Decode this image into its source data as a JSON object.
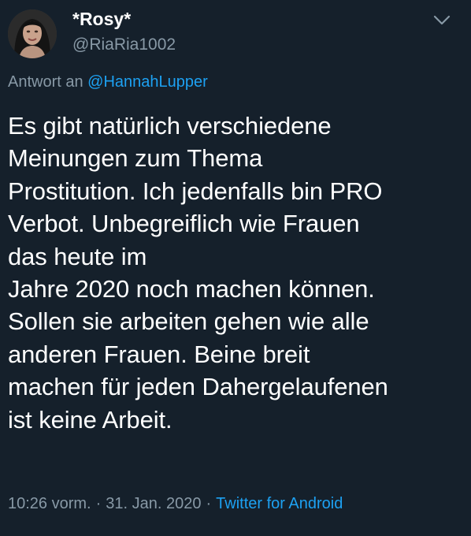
{
  "author": {
    "display_name": "*Rosy*",
    "handle": "@RiaRia1002"
  },
  "reply": {
    "prefix": "Antwort an",
    "mention": "@HannahLupper"
  },
  "tweet": {
    "lines": [
      "Es gibt natürlich verschiedene",
      "Meinungen zum Thema",
      "Prostitution. Ich jedenfalls bin PRO",
      "Verbot. Unbegreiflich wie Frauen",
      "das heute im",
      "Jahre 2020 noch machen können.",
      "Sollen sie arbeiten gehen wie alle",
      "anderen Frauen. Beine breit",
      "machen für jeden Dahergelaufenen",
      "ist keine Arbeit."
    ]
  },
  "meta": {
    "time": "10:26 vorm.",
    "separator": "·",
    "date": "31. Jan. 2020",
    "source": "Twitter for Android"
  },
  "icons": {
    "avatar": "profile-photo",
    "menu": "chevron-down-icon"
  },
  "colors": {
    "background": "#15202b",
    "text": "#ffffff",
    "secondary": "#8899a6",
    "link": "#1da1f2"
  }
}
